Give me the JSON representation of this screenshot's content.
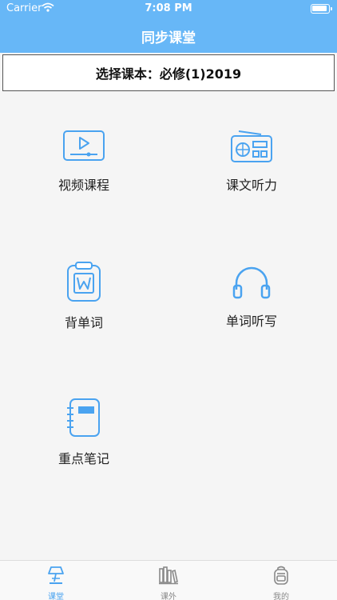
{
  "status": {
    "carrier": "Carrier",
    "time": "7:08 PM"
  },
  "header": {
    "title": "同步课堂"
  },
  "textbook": {
    "label": "选择课本：必修(1)2019"
  },
  "features": [
    {
      "label": "视频课程",
      "icon": "video-player-icon"
    },
    {
      "label": "课文听力",
      "icon": "radio-icon"
    },
    {
      "label": "背单词",
      "icon": "word-clipboard-icon"
    },
    {
      "label": "单词听写",
      "icon": "headphones-icon"
    },
    {
      "label": "重点笔记",
      "icon": "notebook-icon"
    }
  ],
  "tabbar": {
    "tabs": [
      {
        "label": "课堂",
        "icon": "lamp-icon",
        "active": true
      },
      {
        "label": "课外",
        "icon": "books-icon",
        "active": false
      },
      {
        "label": "我的",
        "icon": "backpack-icon",
        "active": false
      }
    ]
  },
  "colors": {
    "accent": "#67b7f7",
    "icon_blue": "#4aa3f0",
    "background": "#f5f5f5"
  }
}
